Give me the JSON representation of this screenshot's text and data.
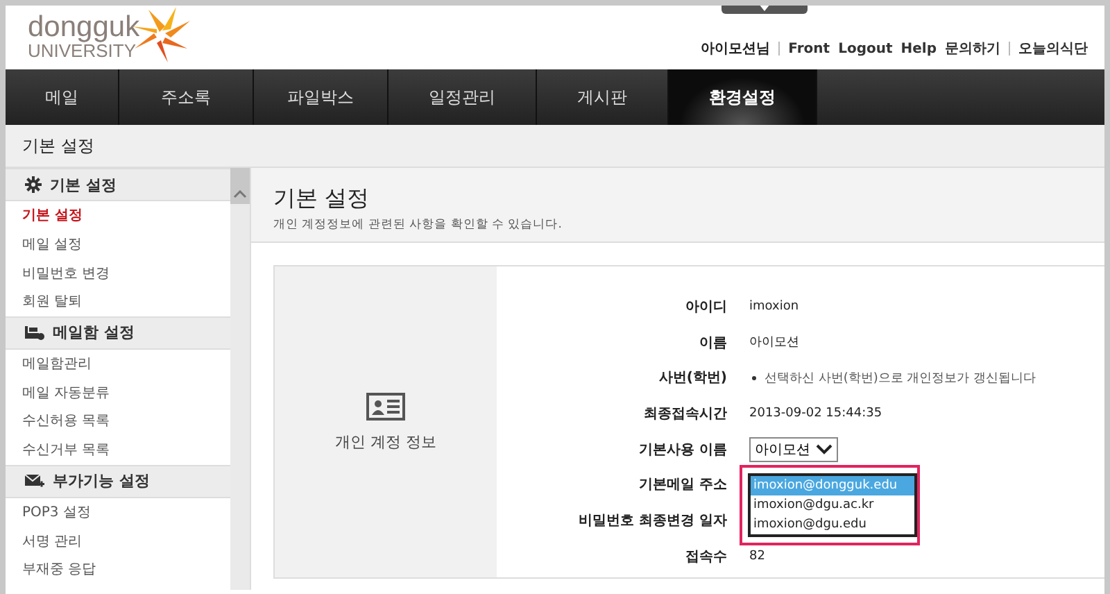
{
  "logo": {
    "line1": "dongguk",
    "line2": "UNIVERSITY"
  },
  "user_links": [
    {
      "label": "아이모션님",
      "kind": "user"
    },
    {
      "label": "Front",
      "kind": "link"
    },
    {
      "label": "Logout",
      "kind": "link"
    },
    {
      "label": "Help",
      "kind": "link"
    },
    {
      "label": "문의하기",
      "kind": "link"
    },
    {
      "label": "오늘의식단",
      "kind": "link"
    }
  ],
  "nav": [
    {
      "label": "메일",
      "selected": false
    },
    {
      "label": "주소록",
      "selected": false
    },
    {
      "label": "파일박스",
      "selected": false
    },
    {
      "label": "일정관리",
      "selected": false
    },
    {
      "label": "게시판",
      "selected": false
    },
    {
      "label": "환경설정",
      "selected": true
    }
  ],
  "breadcrumb": "기본 설정",
  "sidebar": [
    {
      "title": "기본 설정",
      "items": [
        {
          "label": "기본 설정",
          "selected": true
        },
        {
          "label": "메일 설정",
          "selected": false
        },
        {
          "label": "비밀번호 변경",
          "selected": false
        },
        {
          "label": "회원 탈퇴",
          "selected": false
        }
      ]
    },
    {
      "title": "메일함 설정",
      "items": [
        {
          "label": "메일함관리",
          "selected": false
        },
        {
          "label": "메일 자동분류",
          "selected": false
        },
        {
          "label": "수신허용 목록",
          "selected": false
        },
        {
          "label": "수신거부 목록",
          "selected": false
        }
      ]
    },
    {
      "title": "부가기능 설정",
      "items": [
        {
          "label": "POP3 설정",
          "selected": false
        },
        {
          "label": "서명 관리",
          "selected": false
        },
        {
          "label": "부재중 응답",
          "selected": false
        }
      ]
    }
  ],
  "page": {
    "title": "기본 설정",
    "subtitle": "개인 계정정보에 관련된 사항을 확인할 수 있습니다."
  },
  "panel_label": "개인 계정 정보",
  "fields": [
    {
      "label": "아이디",
      "kind": "text",
      "value": "imoxion"
    },
    {
      "label": "이름",
      "kind": "text",
      "value": "아이모션"
    },
    {
      "label": "사번(학번)",
      "kind": "note",
      "value": "선택하신 사번(학번)으로 개인정보가 갱신됩니다"
    },
    {
      "label": "최종접속시간",
      "kind": "text",
      "value": "2013-09-02 15:44:35"
    },
    {
      "label": "기본사용 이름",
      "kind": "select",
      "value": "아이모션"
    },
    {
      "label": "기본메일 주소",
      "kind": "listbox",
      "highlighted": true,
      "options": [
        {
          "label": "imoxion@dongguk.edu",
          "selected": true
        },
        {
          "label": "imoxion@dgu.ac.kr",
          "selected": false
        },
        {
          "label": "imoxion@dgu.edu",
          "selected": false
        }
      ]
    },
    {
      "label": "비밀번호 최종변경 일자",
      "kind": "empty"
    },
    {
      "label": "접속수",
      "kind": "text",
      "value": "82"
    }
  ]
}
